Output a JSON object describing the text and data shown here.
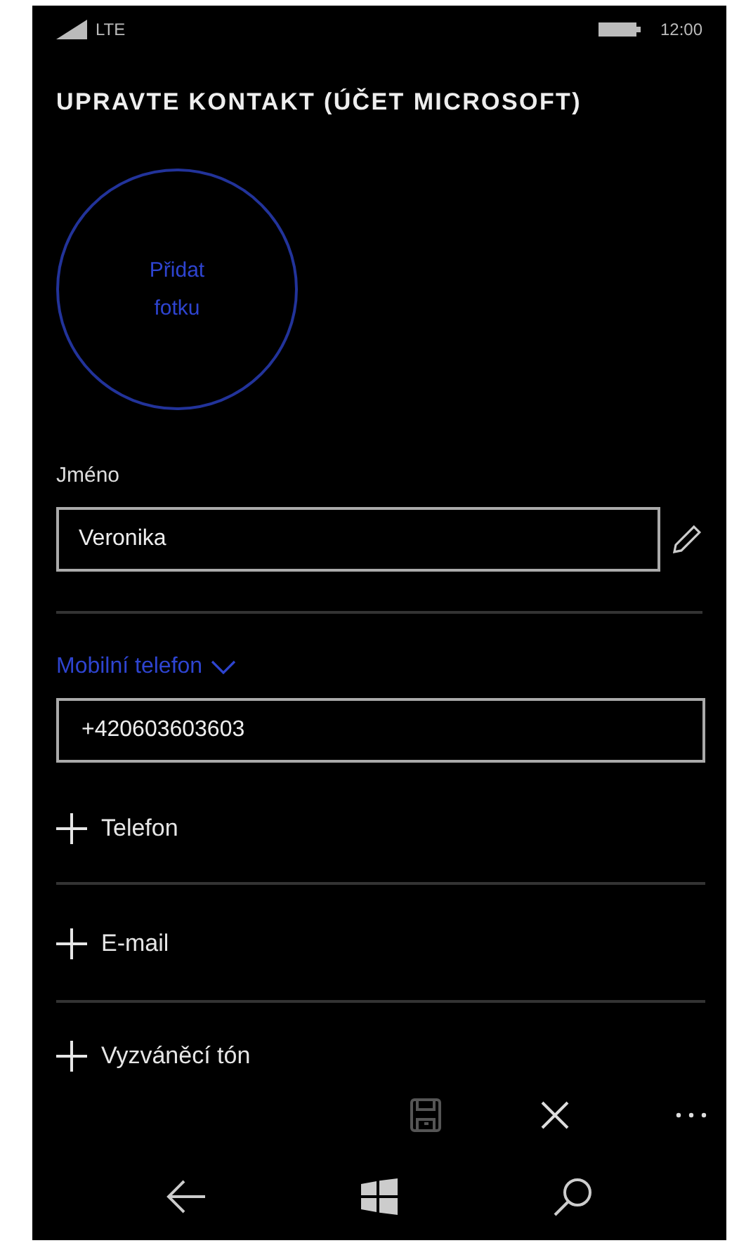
{
  "status_bar": {
    "network": "LTE",
    "time": "12:00"
  },
  "title": "UPRAVTE KONTAKT (ÚČET MICROSOFT)",
  "photo": {
    "label": "Přidat fotku"
  },
  "name_field": {
    "label": "Jméno",
    "value": "Veronika"
  },
  "phone_field": {
    "label": "Mobilní telefon",
    "value": "+420603603603"
  },
  "add_items": [
    {
      "label": "Telefon"
    },
    {
      "label": "E-mail"
    },
    {
      "label": "Vyzváněcí tón"
    }
  ],
  "app_bar": [
    {
      "kind": "save",
      "disabled": true
    },
    {
      "kind": "cancel",
      "disabled": false
    },
    {
      "kind": "more",
      "disabled": false
    }
  ]
}
